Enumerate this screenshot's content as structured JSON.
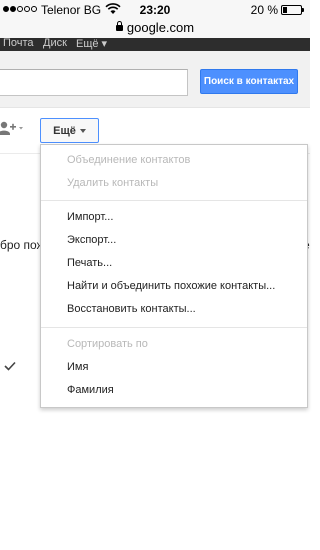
{
  "status_bar": {
    "carrier": "Telenor BG",
    "time": "23:20",
    "battery": "20 %",
    "battery_level_percent": 20,
    "signal_bars_filled": 2,
    "signal_bars_total": 5
  },
  "url_bar": {
    "domain": "google.com"
  },
  "gbar": {
    "items": [
      "Почта",
      "Диск",
      "Ещё ▾"
    ]
  },
  "header": {
    "search_placeholder": "",
    "search_button": "Поиск в контактах"
  },
  "toolbar": {
    "more_label": "Ещё"
  },
  "background": {
    "left_text": "бро пож",
    "right_text": "е"
  },
  "menu": {
    "items": [
      {
        "label": "Объединение контактов",
        "disabled": true
      },
      {
        "label": "Удалить контакты",
        "disabled": true
      },
      {
        "label": "Импорт...",
        "disabled": false
      },
      {
        "label": "Экспорт...",
        "disabled": false
      },
      {
        "label": "Печать...",
        "disabled": false
      },
      {
        "label": "Найти и объединить похожие контакты...",
        "disabled": false
      },
      {
        "label": "Восстановить контакты...",
        "disabled": false
      },
      {
        "label": "Сортировать по",
        "disabled": true
      },
      {
        "label": "Имя",
        "disabled": false,
        "checked": true
      },
      {
        "label": "Фамилия",
        "disabled": false,
        "checked": false
      }
    ]
  },
  "colors": {
    "accent": "#4d90fe",
    "gbar": "#2d2d2d",
    "header": "#f1f1f1"
  },
  "icons": [
    "wifi-icon",
    "lock-icon",
    "battery-icon",
    "add-contact-icon",
    "caret-down-icon",
    "checkmark-icon"
  ]
}
